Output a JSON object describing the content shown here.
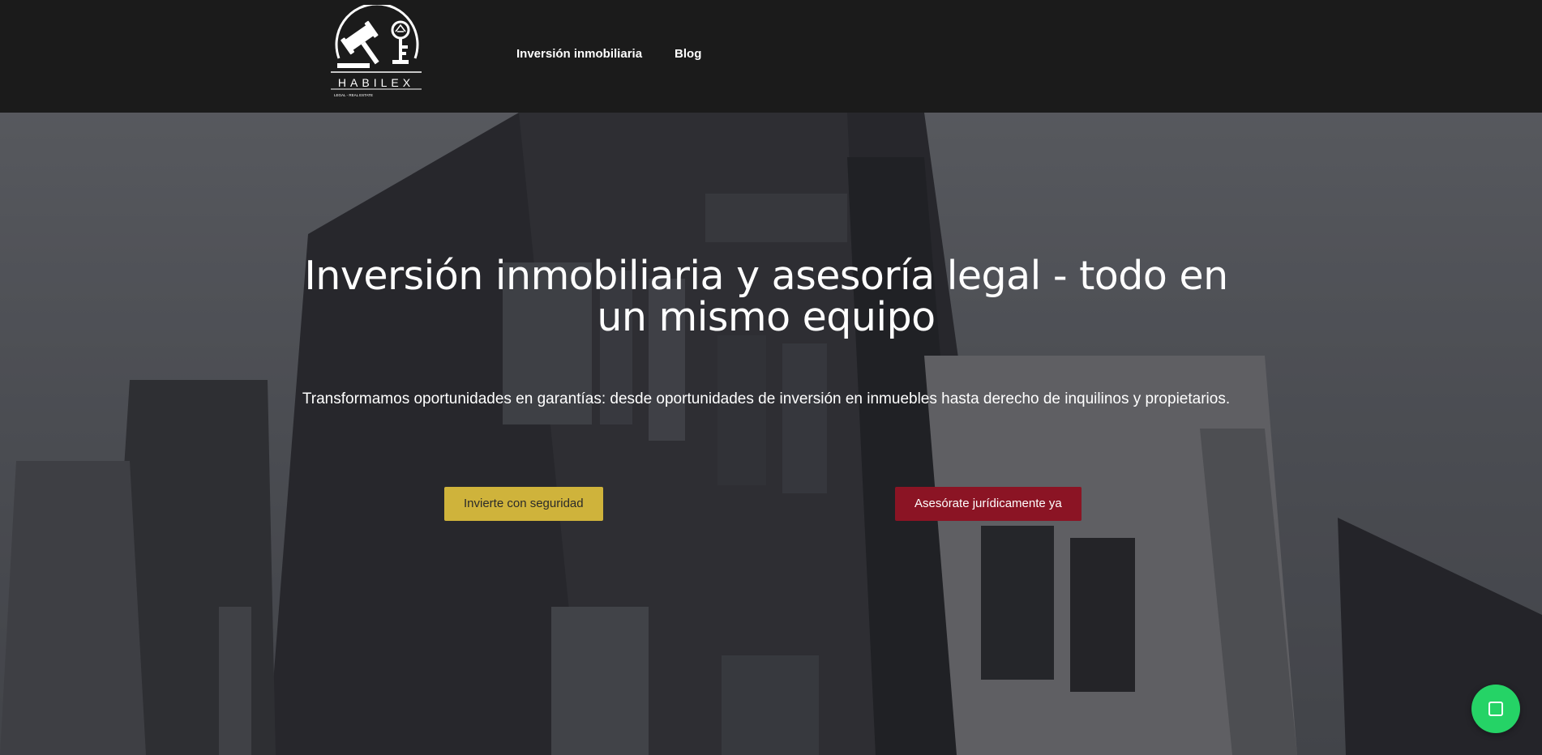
{
  "brand": {
    "logo_text": "HABILEX",
    "logo_tagline": "LEGAL - REAL ESTATE",
    "logo_icon": "gavel-and-key-emblem"
  },
  "nav": {
    "items": [
      {
        "label": "Inversión inmobiliaria"
      },
      {
        "label": "Blog"
      }
    ]
  },
  "hero": {
    "title": "Inversión inmobiliaria y asesoría legal - todo en un mismo equipo",
    "subtitle": "Transformamos oportunidades en garantías: desde oportunidades de inversión en inmuebles hasta derecho de inquilinos y propietarios.",
    "background_icon": "building-photo",
    "buttons": {
      "invest_label": "Invierte con seguridad",
      "legal_label": "Asesórate jurídicamente ya"
    }
  },
  "chat_widget": {
    "icon": "whatsapp-icon"
  },
  "colors": {
    "header_bg": "#1b1b1b",
    "gold": "#cfb33b",
    "burgundy": "#8b1424",
    "whatsapp_green": "#25d366"
  }
}
